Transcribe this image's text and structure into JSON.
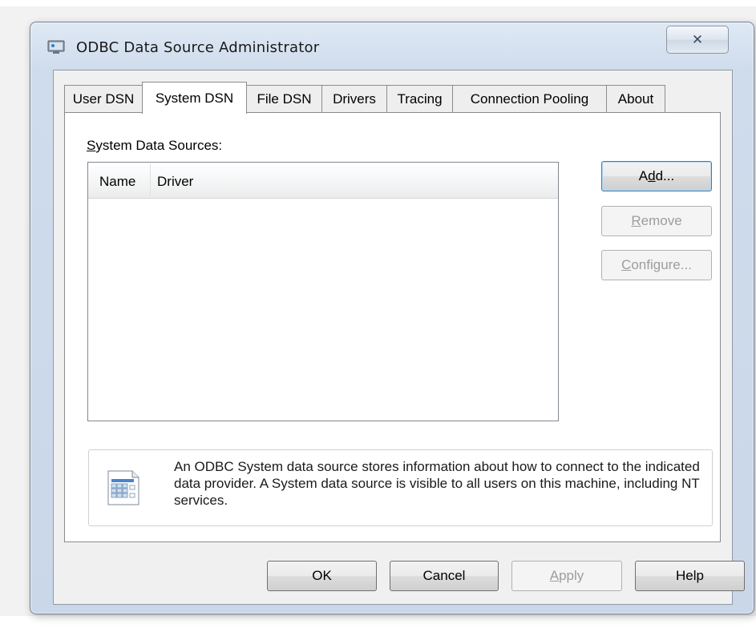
{
  "window": {
    "title": "ODBC Data Source Administrator",
    "close_glyph": "✕"
  },
  "tabs": [
    {
      "label": "User DSN",
      "active": false
    },
    {
      "label": "System DSN",
      "active": true
    },
    {
      "label": "File DSN",
      "active": false
    },
    {
      "label": "Drivers",
      "active": false
    },
    {
      "label": "Tracing",
      "active": false
    },
    {
      "label": "Connection Pooling",
      "active": false
    },
    {
      "label": "About",
      "active": false
    }
  ],
  "panel": {
    "group_label_accel": "S",
    "group_label_rest": "ystem Data Sources:",
    "list": {
      "columns": [
        "Name",
        "Driver"
      ],
      "rows": []
    },
    "buttons": {
      "add": {
        "pre": "A",
        "accel": "d",
        "post": "d...",
        "enabled": true
      },
      "remove": {
        "pre": "",
        "accel": "R",
        "post": "emove",
        "enabled": false
      },
      "configure": {
        "pre": "",
        "accel": "C",
        "post": "onfigure...",
        "enabled": false
      }
    },
    "info": {
      "icon": "data-source-icon",
      "text": "An ODBC System data source stores information about how to connect to the indicated data provider.   A System data source is visible to all users on this machine, including NT services."
    }
  },
  "footer": {
    "ok": "OK",
    "cancel": "Cancel",
    "apply_accel": "A",
    "apply_rest": "pply",
    "help": "Help"
  },
  "colors": {
    "frame": "#cfdcec",
    "client": "#f0f0f0",
    "default_border": "#3c7fb1",
    "disabled_text": "#9d9d9d"
  }
}
